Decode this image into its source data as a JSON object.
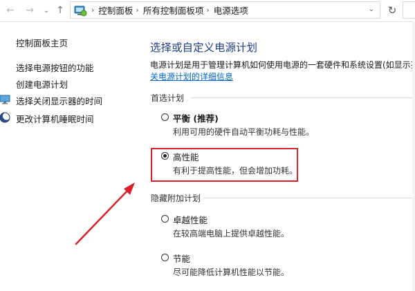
{
  "address_bar": {
    "breadcrumbs": [
      "控制面板",
      "所有控制面板项",
      "电源选项"
    ]
  },
  "left_pane": {
    "home_link": "控制面板主页",
    "links": [
      "选择电源按钮的功能",
      "创建电源计划",
      "选择关闭显示器的时间",
      "更改计算机睡眠时间"
    ]
  },
  "main": {
    "title": "选择或自定义电源计划",
    "description": "电源计划是用于管理计算机如何使用电源的一套硬件和系统设置(如显示亮",
    "more_link": "关电源计划的详细信息",
    "preferred_group": "首选计划",
    "hidden_group": "隐藏附加计划",
    "plans": [
      {
        "name": "平衡 (推荐)",
        "desc": "利用可用的硬件自动平衡功耗与性能。",
        "selected": false
      },
      {
        "name": "高性能",
        "desc": "有利于提高性能，但会增加功耗。",
        "selected": true
      },
      {
        "name": "卓越性能",
        "desc": "在较高端电脑上提供卓越性能。",
        "selected": false
      },
      {
        "name": "节能",
        "desc": "尽可能降低计算机性能以节能。",
        "selected": false
      }
    ]
  },
  "colors": {
    "title_blue": "#1e3f8a",
    "link_blue": "#0066cc",
    "highlight_red": "#d6202a"
  }
}
